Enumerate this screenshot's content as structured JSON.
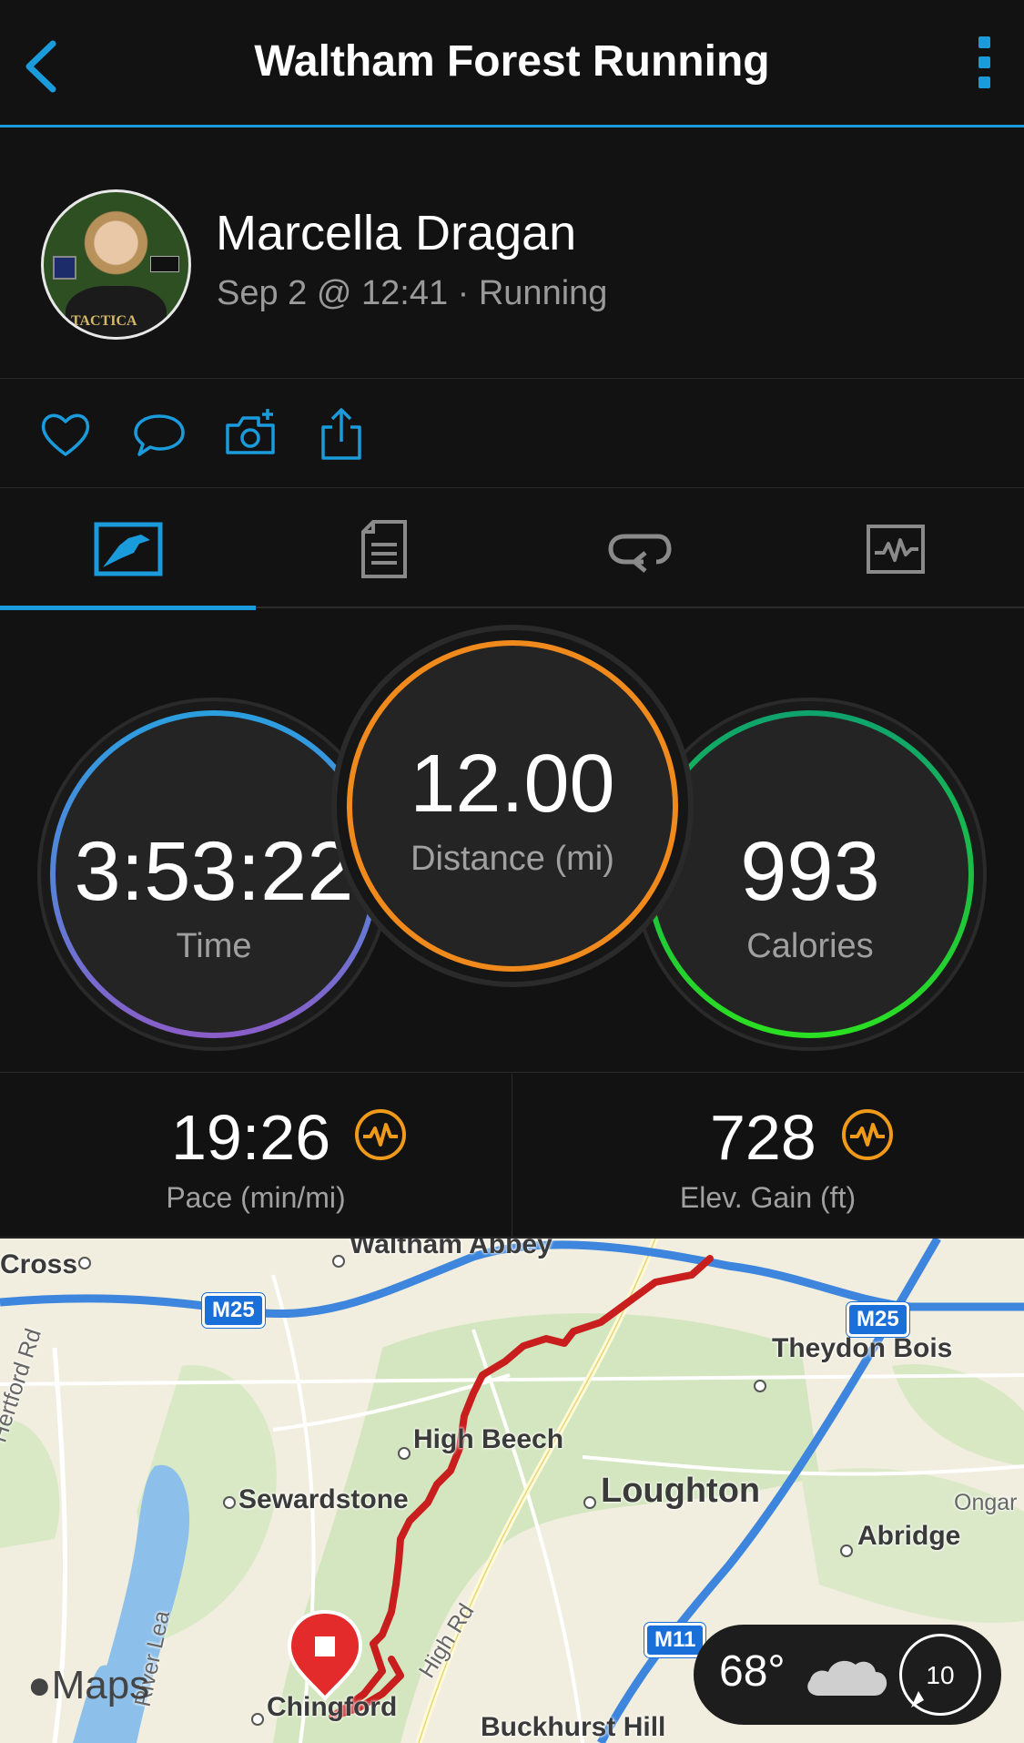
{
  "header": {
    "title": "Waltham Forest Running"
  },
  "profile": {
    "name": "Marcella Dragan",
    "meta": "Sep 2 @ 12:41 · Running",
    "avatar_text": "TACTICA"
  },
  "actions": [
    "like-icon",
    "comment-icon",
    "add-photo-icon",
    "share-icon"
  ],
  "tabs": [
    {
      "icon": "stats-icon",
      "active": true
    },
    {
      "icon": "details-icon",
      "active": false
    },
    {
      "icon": "laps-icon",
      "active": false
    },
    {
      "icon": "charts-icon",
      "active": false
    }
  ],
  "stats": {
    "time": {
      "value": "3:53:22",
      "label": "Time"
    },
    "distance": {
      "value": "12.00",
      "label": "Distance (mi)"
    },
    "calories": {
      "value": "993",
      "label": "Calories"
    }
  },
  "metrics": {
    "pace": {
      "value": "19:26",
      "label": "Pace (min/mi)"
    },
    "elevation": {
      "value": "728",
      "label": "Elev. Gain (ft)"
    }
  },
  "map": {
    "labels": {
      "waltham_abbey": "Waltham Abbey",
      "cross": "Cross",
      "theydon_bois": "Theydon Bois",
      "high_beech": "High Beech",
      "sewardstone": "Sewardstone",
      "loughton": "Loughton",
      "abridge": "Abridge",
      "ongar": "Ongar",
      "hertford_rd": "Hertford Rd",
      "river_lea": "River Lea",
      "high_rd": "High Rd",
      "chingford": "Chingford",
      "buckhurst_hill": "Buckhurst Hill"
    },
    "shields": {
      "m25_left": "M25",
      "m25_right": "M25",
      "m11": "M11"
    },
    "attribution": "Maps",
    "colors": {
      "route": "#c81e1e",
      "road": "#4a90e2",
      "water": "#7fb6e8",
      "park": "#cfe3b8"
    }
  },
  "weather": {
    "temperature": "68°",
    "aqi": "10"
  }
}
